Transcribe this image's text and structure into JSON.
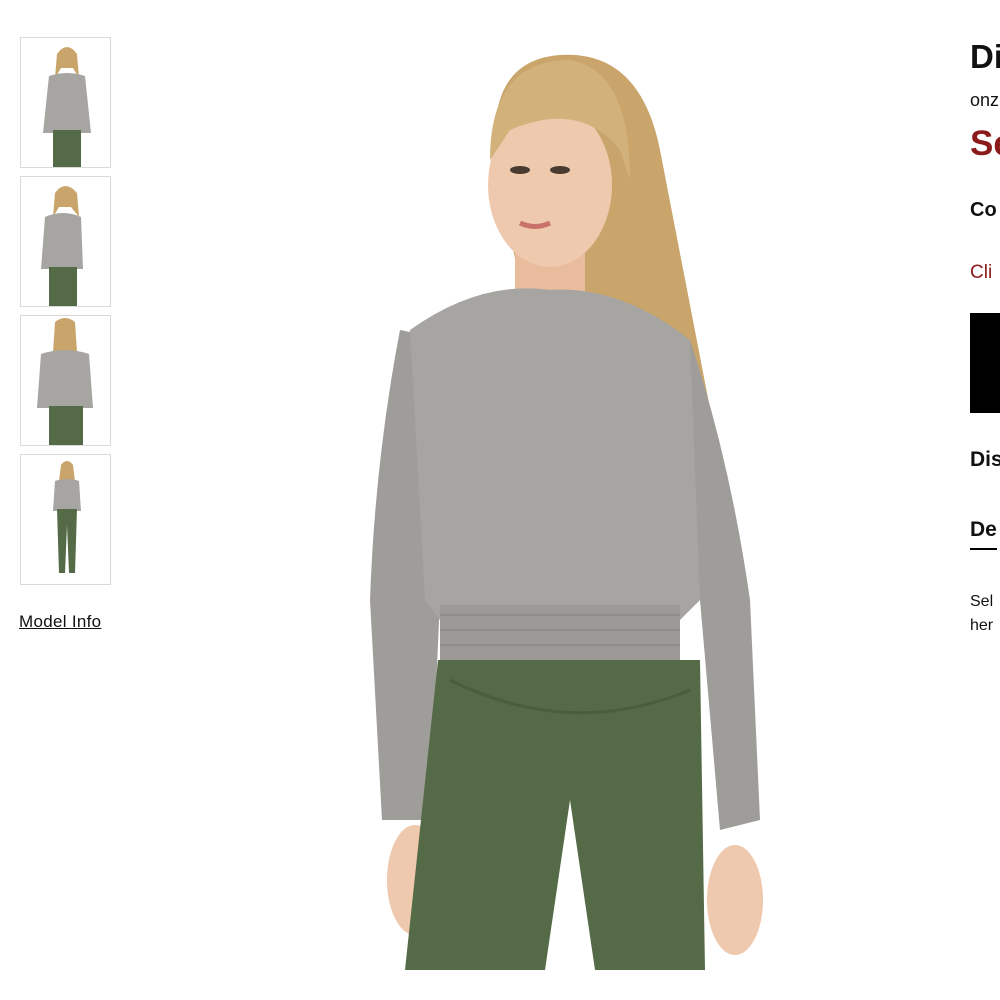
{
  "gallery": {
    "thumbnails": [
      {
        "alt": "Front view"
      },
      {
        "alt": "Side view"
      },
      {
        "alt": "Back view"
      },
      {
        "alt": "Full length view"
      }
    ],
    "model_info_label": "Model Info"
  },
  "product": {
    "brand_fragment": "Di",
    "designer_fragment": "onz",
    "price_fragment": "Se",
    "color_label_fragment": "Co",
    "size_guide_fragment": "Cli",
    "add_to_bag_label": "",
    "disclaimer_fragment": "Dis",
    "details_tab_fragment": "De",
    "description_lines": [
      "Sel",
      "her"
    ]
  },
  "colors": {
    "sweater": "#a7a5a2",
    "leggings": "#556b47",
    "hair": "#c9a56b",
    "skin": "#efc9ad",
    "price": "#8b1a1a",
    "button": "#000000"
  }
}
